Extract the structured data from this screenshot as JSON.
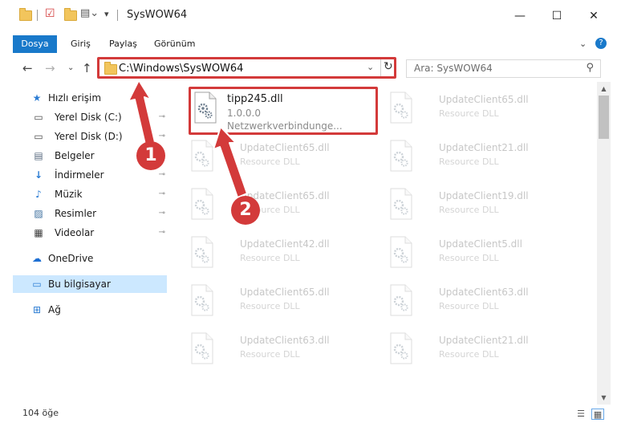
{
  "window": {
    "title": "SysWOW64",
    "minimize": "—",
    "maximize": "☐",
    "close": "✕"
  },
  "ribbon": {
    "tabs": [
      "Dosya",
      "Giriş",
      "Paylaş",
      "Görünüm"
    ],
    "expand": "⌄",
    "help": "?"
  },
  "nav": {
    "back": "←",
    "forward": "→",
    "recent": "⌄",
    "up": "↑",
    "address": "C:\\Windows\\SysWOW64",
    "refresh": "↻",
    "search_placeholder": "Ara: SysWOW64"
  },
  "sidebar": {
    "items": [
      {
        "label": "Hızlı erişim",
        "icon": "star-icon",
        "glyph": "★",
        "color": "#2b7cd3",
        "pin": ""
      },
      {
        "label": "Yerel Disk (C:)",
        "icon": "drive-icon",
        "glyph": "▭",
        "color": "#4a4a4a",
        "pin": "📌"
      },
      {
        "label": "Yerel Disk (D:)",
        "icon": "drive-icon",
        "glyph": "▭",
        "color": "#4a4a4a",
        "pin": "📌"
      },
      {
        "label": "Belgeler",
        "icon": "documents-icon",
        "glyph": "▤",
        "color": "#5a6b80",
        "pin": "📌"
      },
      {
        "label": "İndirmeler",
        "icon": "downloads-icon",
        "glyph": "↓",
        "color": "#2b7cd3",
        "pin": "📌"
      },
      {
        "label": "Müzik",
        "icon": "music-icon",
        "glyph": "♪",
        "color": "#2b7cd3",
        "pin": "📌"
      },
      {
        "label": "Resimler",
        "icon": "pictures-icon",
        "glyph": "▨",
        "color": "#3d6f9e",
        "pin": "📌"
      },
      {
        "label": "Videolar",
        "icon": "videos-icon",
        "glyph": "▦",
        "color": "#3b3b3b",
        "pin": "📌"
      },
      {
        "label": "OneDrive",
        "icon": "onedrive-icon",
        "glyph": "☁",
        "color": "#1d6fd3",
        "pin": ""
      },
      {
        "label": "Bu bilgisayar",
        "icon": "computer-icon",
        "glyph": "▭",
        "color": "#2b7cd3",
        "pin": ""
      },
      {
        "label": "Ağ",
        "icon": "network-icon",
        "glyph": "⊞",
        "color": "#2b7cd3",
        "pin": ""
      }
    ]
  },
  "main_file": {
    "name": "tipp245.dll",
    "version": "1.0.0.0",
    "description": "Netzwerkverbindunge..."
  },
  "files": [
    {
      "name": "UpdateClient65.dll",
      "sub": "Resource DLL"
    },
    {
      "name": "UpdateClient65.dll",
      "sub": "Resource DLL"
    },
    {
      "name": "UpdateClient21.dll",
      "sub": "Resource DLL"
    },
    {
      "name": "UpdateClient65.dll",
      "sub": "Resource DLL"
    },
    {
      "name": "UpdateClient19.dll",
      "sub": "Resource DLL"
    },
    {
      "name": "UpdateClient42.dll",
      "sub": "Resource DLL"
    },
    {
      "name": "UpdateClient5.dll",
      "sub": "Resource DLL"
    },
    {
      "name": "UpdateClient65.dll",
      "sub": "Resource DLL"
    },
    {
      "name": "UpdateClient63.dll",
      "sub": "Resource DLL"
    },
    {
      "name": "UpdateClient63.dll",
      "sub": "Resource DLL"
    },
    {
      "name": "UpdateClient21.dll",
      "sub": "Resource DLL"
    }
  ],
  "annotations": {
    "badge1": "1",
    "badge2": "2",
    "color": "#d33a3a"
  },
  "status": {
    "count": "104 öğe"
  }
}
